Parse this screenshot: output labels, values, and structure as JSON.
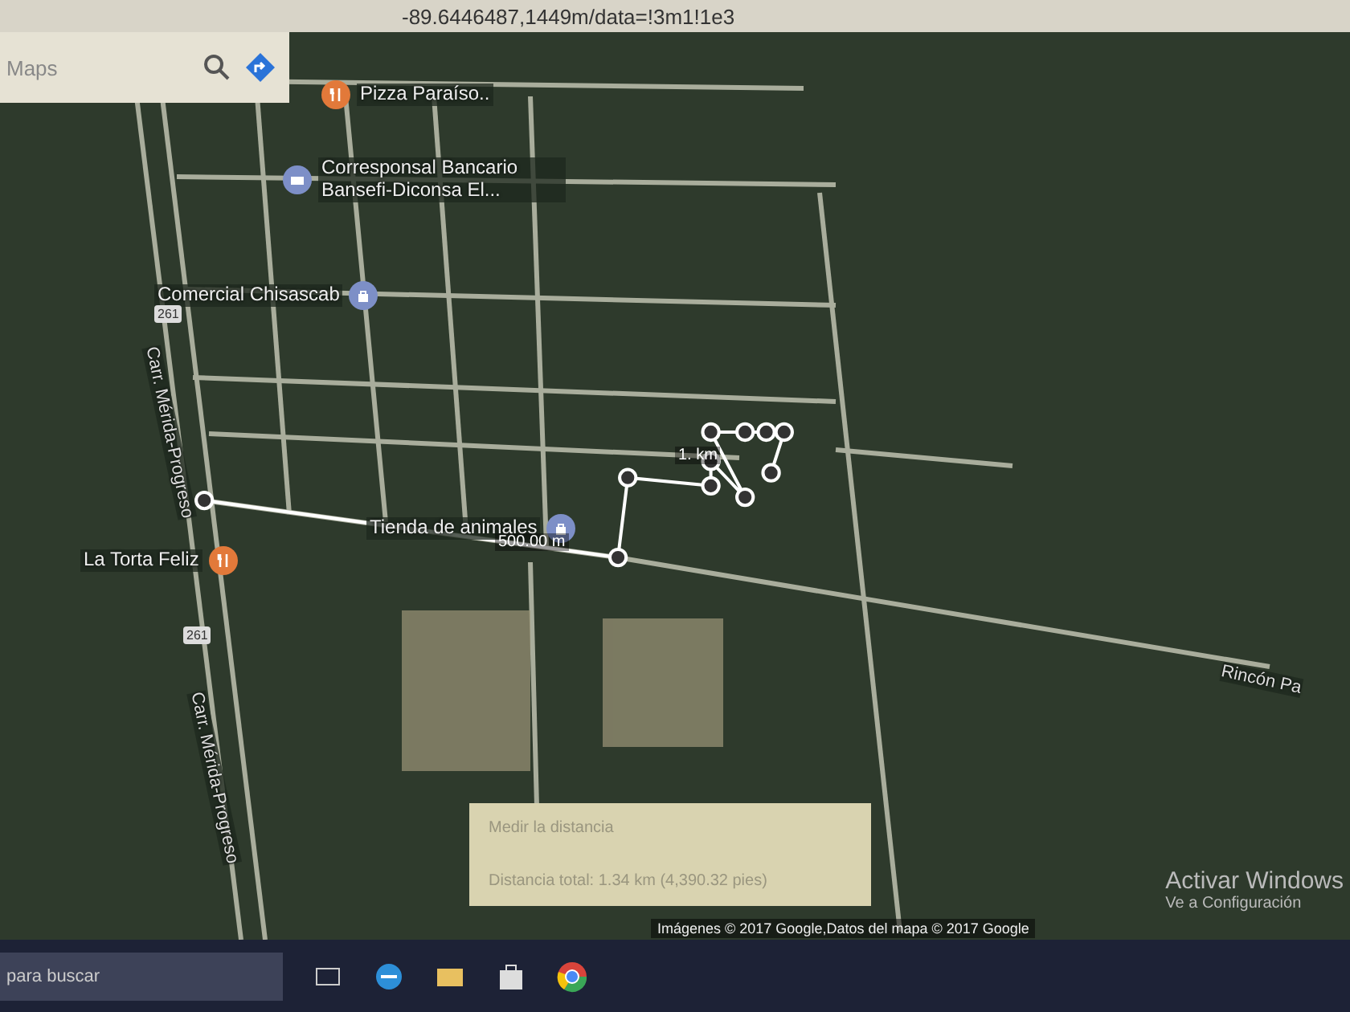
{
  "address_bar": {
    "url": "-89.6446487,1449m/data=!3m1!1e3"
  },
  "search": {
    "placeholder": "Maps"
  },
  "places": [
    {
      "name": "Pizza Paraíso..",
      "kind": "restaurant"
    },
    {
      "name": "Corresponsal Bancario Bansefi-Diconsa El...",
      "kind": "bank"
    },
    {
      "name": "Comercial Chisascab",
      "kind": "shop"
    },
    {
      "name": "Tienda de animales",
      "kind": "shop"
    },
    {
      "name": "La Torta Feliz",
      "kind": "restaurant"
    }
  ],
  "roads": [
    {
      "name": "Carr. Mérida-Progreso",
      "kind": "vertical"
    },
    {
      "name": "Carr. Mérida-Progreso",
      "kind": "vertical"
    },
    {
      "name": "Rincón Pa",
      "kind": "slanted"
    },
    {
      "name": "261",
      "kind": "shield"
    },
    {
      "name": "261",
      "kind": "shield"
    }
  ],
  "measure": {
    "segment_label": "500.00 m",
    "end_label": "1. km"
  },
  "distance_box": {
    "title": "Medir la distancia",
    "total": "Distancia total: 1.34 km (4,390.32 pies)"
  },
  "attribution": "Imágenes © 2017 Google,Datos del mapa © 2017 Google",
  "activation": {
    "title": "Activar Windows",
    "subtitle": "Ve a Configuración"
  },
  "taskbar": {
    "search_placeholder": "para buscar"
  }
}
